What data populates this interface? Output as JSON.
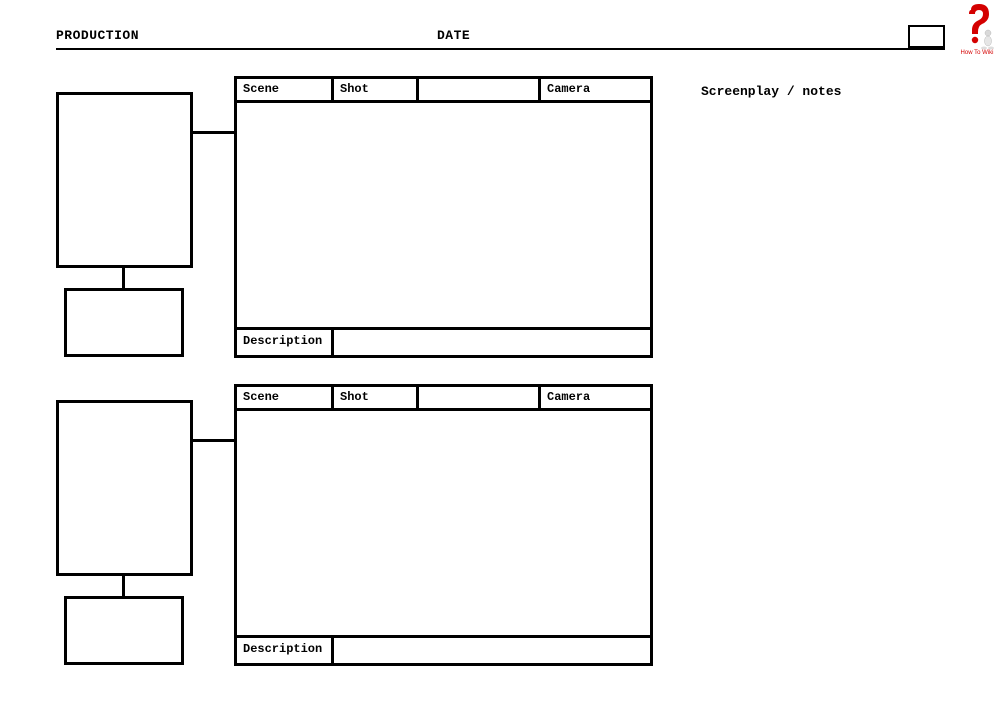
{
  "header": {
    "production_label": "PRODUCTION",
    "date_label": "DATE"
  },
  "logo": {
    "text": "How To Wiki"
  },
  "notes": {
    "label": "Screenplay / notes"
  },
  "panel": {
    "scene_label": "Scene",
    "shot_label": "Shot",
    "camera_label": "Camera",
    "description_label": "Description"
  }
}
